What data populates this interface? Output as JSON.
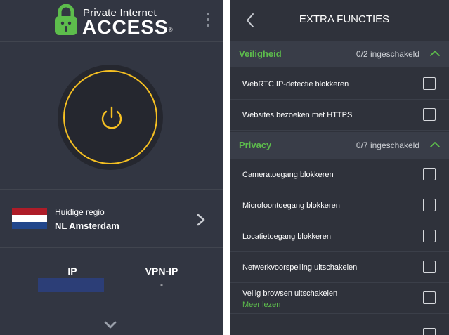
{
  "left": {
    "logo": {
      "top_text": "Private Internet",
      "main_text": "ACCESS",
      "reg_mark": "®"
    },
    "region": {
      "label": "Huidige regio",
      "name": "NL Amsterdam"
    },
    "ip": {
      "ip_label": "IP",
      "vpn_ip_label": "VPN-IP",
      "vpn_ip_value": "-"
    }
  },
  "right": {
    "title": "EXTRA FUNCTIES",
    "sections": [
      {
        "title": "Veiligheid",
        "count": "0/2 ingeschakeld",
        "items": [
          {
            "label": "WebRTC IP-detectie blokkeren"
          },
          {
            "label": "Websites bezoeken met HTTPS"
          }
        ]
      },
      {
        "title": "Privacy",
        "count": "0/7 ingeschakeld",
        "items": [
          {
            "label": "Cameratoegang blokkeren"
          },
          {
            "label": "Microfoontoegang blokkeren"
          },
          {
            "label": "Locatietoegang blokkeren"
          },
          {
            "label": "Netwerkvoorspelling uitschakelen"
          },
          {
            "label": "Veilig browsen uitschakelen",
            "link": "Meer lezen"
          }
        ]
      }
    ]
  },
  "colors": {
    "accent_green": "#5dbd4c",
    "power_yellow": "#f6c022",
    "panel_dark": "#323642"
  }
}
